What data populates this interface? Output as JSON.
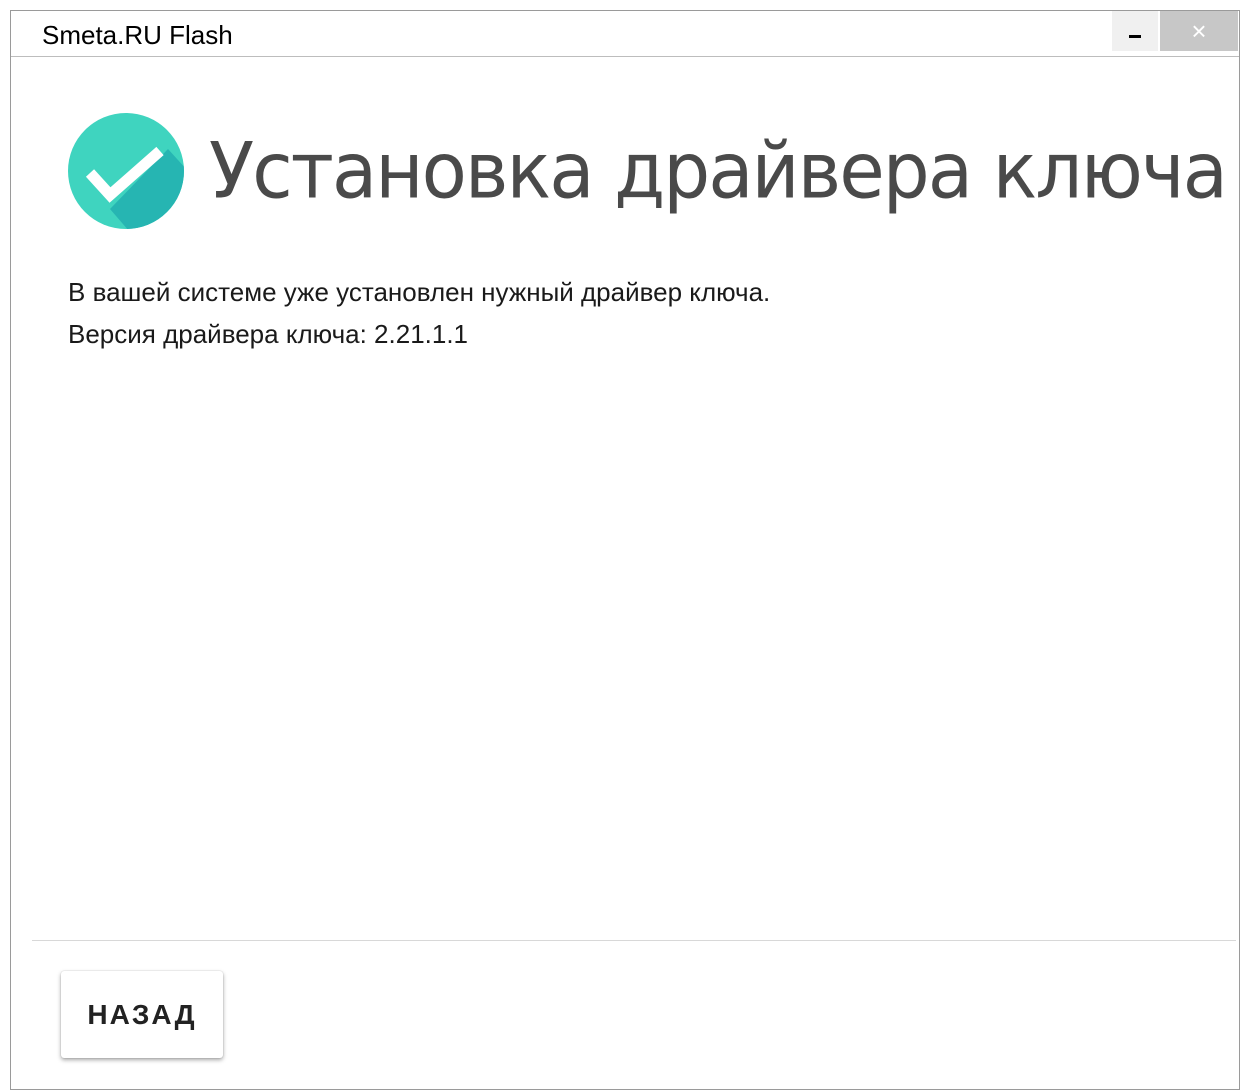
{
  "window": {
    "title": "Smeta.RU Flash",
    "minimize_label": "",
    "close_label": "×"
  },
  "page": {
    "heading": "Установка драйвера ключа",
    "message_line1": "В вашей системе уже установлен нужный драйвер ключа.",
    "message_line2": "Версия драйвера ключа: 2.21.1.1"
  },
  "footer": {
    "back_label": "НАЗАД"
  },
  "icons": {
    "status": "check-circle-icon"
  },
  "colors": {
    "accent_teal": "#3dcfbc",
    "accent_teal_dark": "#26b3b0",
    "close_button_bg": "#c7c7c7"
  }
}
